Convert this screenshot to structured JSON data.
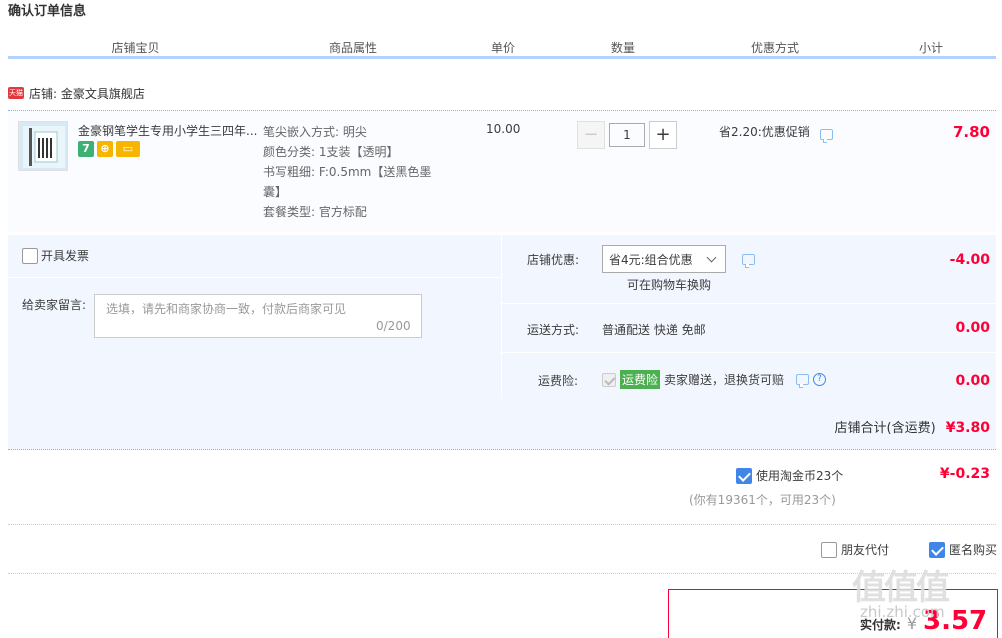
{
  "page": {
    "title": "确认订单信息"
  },
  "table_headers": [
    "店铺宝贝",
    "商品属性",
    "单价",
    "数量",
    "优惠方式",
    "小计"
  ],
  "shop": {
    "badge": "天猫",
    "label": "店铺: 金豪文具旗舰店"
  },
  "item": {
    "title": "金豪钢笔学生专用小学生三四年...",
    "badges": [
      {
        "text": "7",
        "color": "#3bb273"
      },
      {
        "text": "⊕",
        "color": "#f7b500"
      },
      {
        "text": "▭",
        "color": "#f7b500"
      }
    ],
    "props": [
      "笔尖嵌入方式: 明尖",
      "颜色分类: 1支装【透明】",
      "书写粗细: F:0.5mm【送黑色墨",
      "囊】",
      "套餐类型: 官方标配"
    ],
    "unit_price": "10.00",
    "quantity": "1",
    "qty_minus": "−",
    "qty_plus": "+",
    "promotion": "省2.20:优惠促销",
    "subtotal": "7.80"
  },
  "options": {
    "invoice_label": "开具发票",
    "message_label": "给卖家留言:",
    "message_placeholder": "选填，请先和商家协商一致，付款后商家可见",
    "message_count": "0/200",
    "shop_discount_label": "店铺优惠:",
    "shop_discount_value": "省4元:组合优惠",
    "shop_discount_note": "可在购物车换购",
    "shop_discount_amount": "-4.00",
    "shipping_label": "运送方式:",
    "shipping_value": "普通配送 快递 免邮",
    "shipping_amount": "0.00",
    "insurance_label": "运费险:",
    "insurance_tag": "运费险",
    "insurance_desc": "卖家赠送，退换货可赔",
    "insurance_amount": "0.00",
    "help_icon": "?"
  },
  "shop_total": {
    "label": "店铺合计(含运费)",
    "amount": "¥3.80"
  },
  "coins": {
    "label": "使用淘金币23个",
    "amount": "¥-0.23",
    "note": "(你有19361个，可用23个)"
  },
  "extras": {
    "friend_pay": "朋友代付",
    "anonymous": "匿名购买"
  },
  "payment": {
    "label": "实付款:",
    "currency": "¥",
    "amount": "3.57"
  },
  "watermark": {
    "logo": "值值值",
    "site": "zhi.zhi.com"
  },
  "colors": {
    "accent": "#ff0036",
    "header_border": "#b2d1ff",
    "panel_bg": "#f2f7ff",
    "checkbox_on": "#3f86e8"
  }
}
